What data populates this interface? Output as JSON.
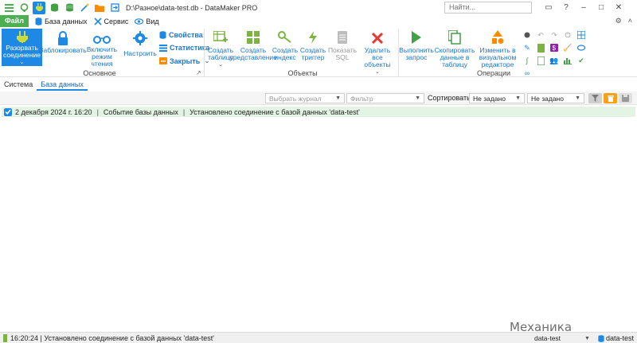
{
  "window": {
    "title": "D:\\Разное\\data-test.db - DataMaker PRO",
    "search_placeholder": "Найти..."
  },
  "menu": {
    "file": "Файл",
    "database": "База данных",
    "service": "Сервис",
    "view": "Вид"
  },
  "ribbon": {
    "main": {
      "disconnect": "Разорвать соединение",
      "lock": "Заблокировать",
      "readonly": "Включить режим чтения",
      "configure": "Настроить",
      "properties": "Свойства",
      "statistics": "Статистика",
      "close": "Закрыть",
      "group": "Основное"
    },
    "objects": {
      "create_table": "Создать таблицу",
      "create_view": "Создать представление",
      "create_index": "Создать индекс",
      "create_trigger": "Создать триггер",
      "show_sql": "Показать SQL",
      "delete_all": "Удалить все объекты",
      "group": "Объекты"
    },
    "operations": {
      "run_query": "Выполнить запрос",
      "copy_data": "Скопировать данные в таблицу",
      "visual_editor": "Изменить в визуальном редакторе",
      "group": "Операции"
    }
  },
  "tabs": {
    "system": "Система",
    "database": "База данных"
  },
  "filter": {
    "journal_placeholder": "Выбрать журнал",
    "filter_placeholder": "Фильтр",
    "sort_label": "Сортировать:",
    "sort_value": "Не задано",
    "sort_order": "Не задано"
  },
  "log": [
    {
      "date": "2 декабря 2024 г. 16:20",
      "type": "Событие базы данных",
      "message": "Установлено соединение с базой данных 'data-test'"
    }
  ],
  "status": {
    "message": "16:20:24 | Установлено соединение с базой данных 'data-test'",
    "db_select": "data-test",
    "db_current": "data-test"
  },
  "watermark": "Механика вселенной",
  "colors": {
    "accent": "#1e88e5",
    "file_menu": "#4caf50",
    "log_row": "#e3f4e5",
    "active_status": "#f7a11a"
  }
}
